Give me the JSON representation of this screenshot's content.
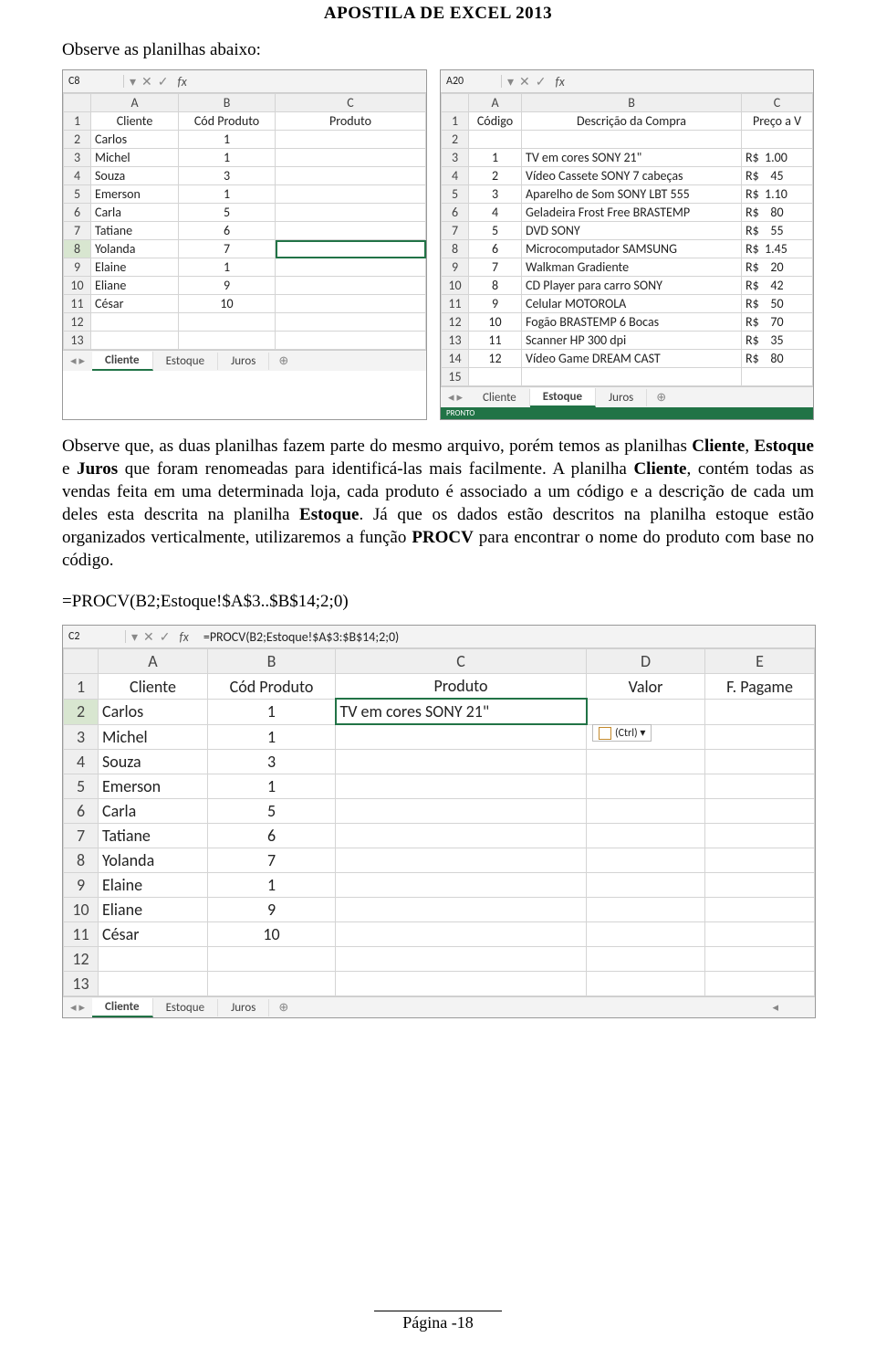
{
  "doc": {
    "title": "APOSTILA DE EXCEL 2013",
    "intro": "Observe as planilhas abaixo:",
    "body": "Observe que, as duas planilhas fazem parte do mesmo arquivo, porém temos as planilhas Cliente, Estoque e Juros que foram renomeadas para identificá-las mais facilmente. A planilha Cliente, contém todas as vendas feita em uma determinada loja, cada produto é associado a um código e a descrição de cada um deles esta descrita na planilha Estoque. Já que os dados estão descritos na planilha estoque estão organizados verticalmente, utilizaremos a função PROCV para encontrar o nome do produto com base no código.",
    "formula": "=PROCV(B2;Estoque!$A$3..$B$14;2;0)",
    "footer": "Página -18"
  },
  "shot1": {
    "cellref": "C8",
    "cols": [
      "A",
      "B",
      "C"
    ],
    "headers": {
      "a": "Cliente",
      "b": "Cód Produto",
      "c": "Produto"
    },
    "rows": [
      {
        "n": "1"
      },
      {
        "n": "2",
        "a": "Carlos",
        "b": "1"
      },
      {
        "n": "3",
        "a": "Michel",
        "b": "1"
      },
      {
        "n": "4",
        "a": "Souza",
        "b": "3"
      },
      {
        "n": "5",
        "a": "Emerson",
        "b": "1"
      },
      {
        "n": "6",
        "a": "Carla",
        "b": "5"
      },
      {
        "n": "7",
        "a": "Tatiane",
        "b": "6"
      },
      {
        "n": "8",
        "a": "Yolanda",
        "b": "7"
      },
      {
        "n": "9",
        "a": "Elaine",
        "b": "1"
      },
      {
        "n": "10",
        "a": "Eliane",
        "b": "9"
      },
      {
        "n": "11",
        "a": "César",
        "b": "10"
      },
      {
        "n": "12"
      },
      {
        "n": "13"
      }
    ],
    "tabs": [
      "Cliente",
      "Estoque",
      "Juros"
    ],
    "active": "Cliente"
  },
  "shot2": {
    "cellref": "A20",
    "cols": [
      "A",
      "B",
      "C"
    ],
    "headers": {
      "a": "Código",
      "b": "Descrição da Compra",
      "c": "Preço a V"
    },
    "currency": "R$",
    "rows": [
      {
        "n": "1"
      },
      {
        "n": "2"
      },
      {
        "n": "3",
        "a": "1",
        "b": "TV em cores SONY 21\"",
        "c": "1.00"
      },
      {
        "n": "4",
        "a": "2",
        "b": "Vídeo Cassete SONY 7 cabeças",
        "c": "45"
      },
      {
        "n": "5",
        "a": "3",
        "b": "Aparelho de Som SONY LBT 555",
        "c": "1.10"
      },
      {
        "n": "6",
        "a": "4",
        "b": "Geladeira Frost Free BRASTEMP",
        "c": "80"
      },
      {
        "n": "7",
        "a": "5",
        "b": "DVD SONY",
        "c": "55"
      },
      {
        "n": "8",
        "a": "6",
        "b": "Microcomputador SAMSUNG",
        "c": "1.45"
      },
      {
        "n": "9",
        "a": "7",
        "b": "Walkman Gradiente",
        "c": "20"
      },
      {
        "n": "10",
        "a": "8",
        "b": "CD Player para carro SONY",
        "c": "42"
      },
      {
        "n": "11",
        "a": "9",
        "b": "Celular MOTOROLA",
        "c": "50"
      },
      {
        "n": "12",
        "a": "10",
        "b": "Fogão BRASTEMP 6 Bocas",
        "c": "70"
      },
      {
        "n": "13",
        "a": "11",
        "b": "Scanner HP 300 dpi",
        "c": "35"
      },
      {
        "n": "14",
        "a": "12",
        "b": "Vídeo Game DREAM CAST",
        "c": "80"
      },
      {
        "n": "15"
      }
    ],
    "tabs": [
      "Cliente",
      "Estoque",
      "Juros"
    ],
    "active": "Estoque",
    "status": "PRONTO"
  },
  "shot3": {
    "cellref": "C2",
    "formula": "=PROCV(B2;Estoque!$A$3:$B$14;2;0)",
    "cols": [
      "A",
      "B",
      "C",
      "D",
      "E"
    ],
    "headers": {
      "a": "Cliente",
      "b": "Cód Produto",
      "c": "Produto",
      "d": "Valor",
      "e": "F. Pagame"
    },
    "ctrl_hint": "(Ctrl) ▾",
    "rows": [
      {
        "n": "1"
      },
      {
        "n": "2",
        "a": "Carlos",
        "b": "1",
        "c": "TV em cores SONY 21\""
      },
      {
        "n": "3",
        "a": "Michel",
        "b": "1"
      },
      {
        "n": "4",
        "a": "Souza",
        "b": "3"
      },
      {
        "n": "5",
        "a": "Emerson",
        "b": "1"
      },
      {
        "n": "6",
        "a": "Carla",
        "b": "5"
      },
      {
        "n": "7",
        "a": "Tatiane",
        "b": "6"
      },
      {
        "n": "8",
        "a": "Yolanda",
        "b": "7"
      },
      {
        "n": "9",
        "a": "Elaine",
        "b": "1"
      },
      {
        "n": "10",
        "a": "Eliane",
        "b": "9"
      },
      {
        "n": "11",
        "a": "César",
        "b": "10"
      },
      {
        "n": "12"
      },
      {
        "n": "13"
      }
    ],
    "tabs": [
      "Cliente",
      "Estoque",
      "Juros"
    ],
    "active": "Cliente"
  }
}
